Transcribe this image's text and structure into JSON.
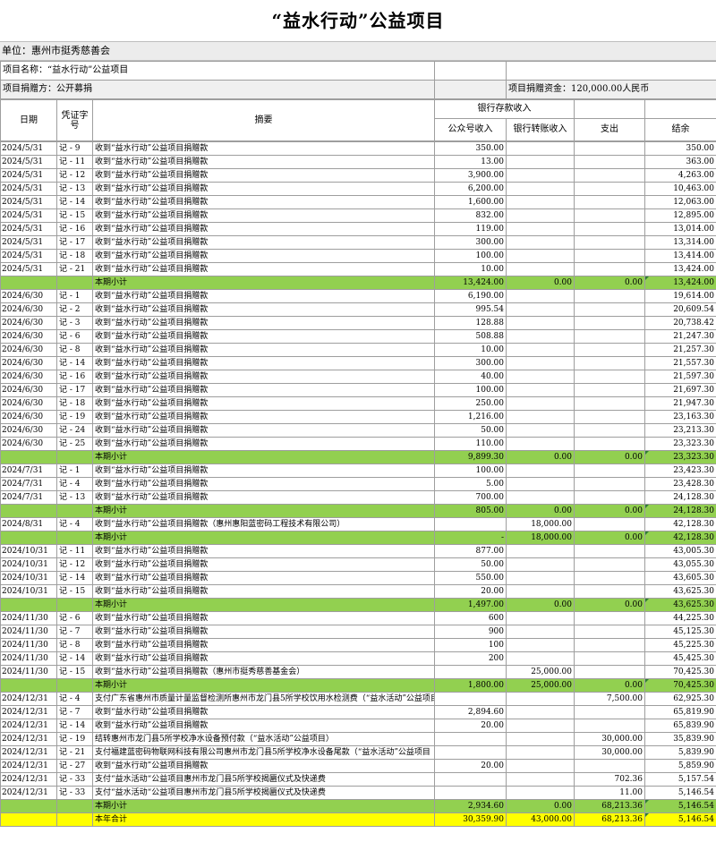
{
  "title": "“益水行动”公益项目",
  "unit_label": "单位：惠州市挺秀慈善会",
  "project_name": "项目名称：“益水行动”公益项目",
  "donation_method": "项目捐赠方：公开募捐",
  "donation_fund": "项目捐赠资金：120,000.00人民币",
  "headers": {
    "date": "日期",
    "voucher": "凭证字号",
    "summary": "摘要",
    "bank": "银行存款收入",
    "public_income": "公众号收入",
    "transfer_income": "银行转账收入",
    "expense": "支出",
    "balance": "结余"
  },
  "rows": [
    {
      "type": "entry",
      "date": "2024/5/31",
      "voucher": "记 - 9",
      "summary": "收到“益水行动”公益项目捐赠款",
      "pub": "350.00",
      "trans": "",
      "exp": "",
      "bal": "350.00"
    },
    {
      "type": "entry",
      "date": "2024/5/31",
      "voucher": "记 - 11",
      "summary": "收到“益水行动”公益项目捐赠款",
      "pub": "13.00",
      "trans": "",
      "exp": "",
      "bal": "363.00"
    },
    {
      "type": "entry",
      "date": "2024/5/31",
      "voucher": "记 - 12",
      "summary": "收到“益水行动”公益项目捐赠款",
      "pub": "3,900.00",
      "trans": "",
      "exp": "",
      "bal": "4,263.00"
    },
    {
      "type": "entry",
      "date": "2024/5/31",
      "voucher": "记 - 13",
      "summary": "收到“益水行动”公益项目捐赠款",
      "pub": "6,200.00",
      "trans": "",
      "exp": "",
      "bal": "10,463.00"
    },
    {
      "type": "entry",
      "date": "2024/5/31",
      "voucher": "记 - 14",
      "summary": "收到“益水行动”公益项目捐赠款",
      "pub": "1,600.00",
      "trans": "",
      "exp": "",
      "bal": "12,063.00"
    },
    {
      "type": "entry",
      "date": "2024/5/31",
      "voucher": "记 - 15",
      "summary": "收到“益水行动”公益项目捐赠款",
      "pub": "832.00",
      "trans": "",
      "exp": "",
      "bal": "12,895.00"
    },
    {
      "type": "entry",
      "date": "2024/5/31",
      "voucher": "记 - 16",
      "summary": "收到“益水行动”公益项目捐赠款",
      "pub": "119.00",
      "trans": "",
      "exp": "",
      "bal": "13,014.00"
    },
    {
      "type": "entry",
      "date": "2024/5/31",
      "voucher": "记 - 17",
      "summary": "收到“益水行动”公益项目捐赠款",
      "pub": "300.00",
      "trans": "",
      "exp": "",
      "bal": "13,314.00"
    },
    {
      "type": "entry",
      "date": "2024/5/31",
      "voucher": "记 - 18",
      "summary": "收到“益水行动”公益项目捐赠款",
      "pub": "100.00",
      "trans": "",
      "exp": "",
      "bal": "13,414.00"
    },
    {
      "type": "entry",
      "date": "2024/5/31",
      "voucher": "记 - 21",
      "summary": "收到“益水行动”公益项目捐赠款",
      "pub": "10.00",
      "trans": "",
      "exp": "",
      "bal": "13,424.00"
    },
    {
      "type": "sub",
      "summary": "本期小计",
      "pub": "13,424.00",
      "trans": "0.00",
      "exp": "0.00",
      "bal": "13,424.00"
    },
    {
      "type": "entry",
      "date": "2024/6/30",
      "voucher": "记 - 1",
      "summary": "收到“益水行动”公益项目捐赠款",
      "pub": "6,190.00",
      "trans": "",
      "exp": "",
      "bal": "19,614.00"
    },
    {
      "type": "entry",
      "date": "2024/6/30",
      "voucher": "记 - 2",
      "summary": "收到“益水行动”公益项目捐赠款",
      "pub": "995.54",
      "trans": "",
      "exp": "",
      "bal": "20,609.54"
    },
    {
      "type": "entry",
      "date": "2024/6/30",
      "voucher": "记 - 3",
      "summary": "收到“益水行动”公益项目捐赠款",
      "pub": "128.88",
      "trans": "",
      "exp": "",
      "bal": "20,738.42"
    },
    {
      "type": "entry",
      "date": "2024/6/30",
      "voucher": "记 - 6",
      "summary": "收到“益水行动”公益项目捐赠款",
      "pub": "508.88",
      "trans": "",
      "exp": "",
      "bal": "21,247.30"
    },
    {
      "type": "entry",
      "date": "2024/6/30",
      "voucher": "记 - 8",
      "summary": "收到“益水行动”公益项目捐赠款",
      "pub": "10.00",
      "trans": "",
      "exp": "",
      "bal": "21,257.30"
    },
    {
      "type": "entry",
      "date": "2024/6/30",
      "voucher": "记 - 14",
      "summary": "收到“益水行动”公益项目捐赠款",
      "pub": "300.00",
      "trans": "",
      "exp": "",
      "bal": "21,557.30"
    },
    {
      "type": "entry",
      "date": "2024/6/30",
      "voucher": "记 - 16",
      "summary": "收到“益水行动”公益项目捐赠款",
      "pub": "40.00",
      "trans": "",
      "exp": "",
      "bal": "21,597.30"
    },
    {
      "type": "entry",
      "date": "2024/6/30",
      "voucher": "记 - 17",
      "summary": "收到“益水行动”公益项目捐赠款",
      "pub": "100.00",
      "trans": "",
      "exp": "",
      "bal": "21,697.30"
    },
    {
      "type": "entry",
      "date": "2024/6/30",
      "voucher": "记 - 18",
      "summary": "收到“益水行动”公益项目捐赠款",
      "pub": "250.00",
      "trans": "",
      "exp": "",
      "bal": "21,947.30"
    },
    {
      "type": "entry",
      "date": "2024/6/30",
      "voucher": "记 - 19",
      "summary": "收到“益水行动”公益项目捐赠款",
      "pub": "1,216.00",
      "trans": "",
      "exp": "",
      "bal": "23,163.30"
    },
    {
      "type": "entry",
      "date": "2024/6/30",
      "voucher": "记 - 24",
      "summary": "收到“益水行动”公益项目捐赠款",
      "pub": "50.00",
      "trans": "",
      "exp": "",
      "bal": "23,213.30"
    },
    {
      "type": "entry",
      "date": "2024/6/30",
      "voucher": "记 - 25",
      "summary": "收到“益水行动”公益项目捐赠款",
      "pub": "110.00",
      "trans": "",
      "exp": "",
      "bal": "23,323.30"
    },
    {
      "type": "sub",
      "summary": "本期小计",
      "pub": "9,899.30",
      "trans": "0.00",
      "exp": "0.00",
      "bal": "23,323.30"
    },
    {
      "type": "entry",
      "date": "2024/7/31",
      "voucher": "记 - 1",
      "summary": "收到“益水行动”公益项目捐赠款",
      "pub": "100.00",
      "trans": "",
      "exp": "",
      "bal": "23,423.30"
    },
    {
      "type": "entry",
      "date": "2024/7/31",
      "voucher": "记 - 4",
      "summary": "收到“益水行动”公益项目捐赠款",
      "pub": "5.00",
      "trans": "",
      "exp": "",
      "bal": "23,428.30"
    },
    {
      "type": "entry",
      "date": "2024/7/31",
      "voucher": "记 - 13",
      "summary": "收到“益水行动”公益项目捐赠款",
      "pub": "700.00",
      "trans": "",
      "exp": "",
      "bal": "24,128.30"
    },
    {
      "type": "sub",
      "summary": "本期小计",
      "pub": "805.00",
      "trans": "0.00",
      "exp": "0.00",
      "bal": "24,128.30"
    },
    {
      "type": "entry",
      "date": "2024/8/31",
      "voucher": "记 - 4",
      "summary": "收到“益水行动”公益项目捐赠款（惠州惠阳蓝密码工程技术有限公司）",
      "pub": "",
      "trans": "18,000.00",
      "exp": "",
      "bal": "42,128.30"
    },
    {
      "type": "sub",
      "summary": "本期小计",
      "pub": "-",
      "trans": "18,000.00",
      "exp": "0.00",
      "bal": "42,128.30"
    },
    {
      "type": "entry",
      "date": "2024/10/31",
      "voucher": "记 - 11",
      "summary": "收到“益水行动”公益项目捐赠款",
      "pub": "877.00",
      "trans": "",
      "exp": "",
      "bal": "43,005.30"
    },
    {
      "type": "entry",
      "date": "2024/10/31",
      "voucher": "记 - 12",
      "summary": "收到“益水行动”公益项目捐赠款",
      "pub": "50.00",
      "trans": "",
      "exp": "",
      "bal": "43,055.30"
    },
    {
      "type": "entry",
      "date": "2024/10/31",
      "voucher": "记 - 14",
      "summary": "收到“益水行动”公益项目捐赠款",
      "pub": "550.00",
      "trans": "",
      "exp": "",
      "bal": "43,605.30"
    },
    {
      "type": "entry",
      "date": "2024/10/31",
      "voucher": "记 - 15",
      "summary": "收到“益水行动”公益项目捐赠款",
      "pub": "20.00",
      "trans": "",
      "exp": "",
      "bal": "43,625.30"
    },
    {
      "type": "sub",
      "summary": "本期小计",
      "pub": "1,497.00",
      "trans": "0.00",
      "exp": "0.00",
      "bal": "43,625.30"
    },
    {
      "type": "entry",
      "date": "2024/11/30",
      "voucher": "记 - 6",
      "summary": "收到“益水行动”公益项目捐赠款",
      "pub": "600",
      "trans": "",
      "exp": "",
      "bal": "44,225.30"
    },
    {
      "type": "entry",
      "date": "2024/11/30",
      "voucher": "记 - 7",
      "summary": "收到“益水行动”公益项目捐赠款",
      "pub": "900",
      "trans": "",
      "exp": "",
      "bal": "45,125.30"
    },
    {
      "type": "entry",
      "date": "2024/11/30",
      "voucher": "记 - 8",
      "summary": "收到“益水行动”公益项目捐赠款",
      "pub": "100",
      "trans": "",
      "exp": "",
      "bal": "45,225.30"
    },
    {
      "type": "entry",
      "date": "2024/11/30",
      "voucher": "记 - 14",
      "summary": "收到“益水行动”公益项目捐赠款",
      "pub": "200",
      "trans": "",
      "exp": "",
      "bal": "45,425.30"
    },
    {
      "type": "entry",
      "date": "2024/11/30",
      "voucher": "记 - 15",
      "summary": "收到“益水行动”公益项目捐赠款（惠州市挺秀慈善基金会）",
      "pub": "",
      "trans": "25,000.00",
      "exp": "",
      "bal": "70,425.30"
    },
    {
      "type": "sub",
      "summary": "本期小计",
      "pub": "1,800.00",
      "trans": "25,000.00",
      "exp": "0.00",
      "bal": "70,425.30"
    },
    {
      "type": "entry",
      "date": "2024/12/31",
      "voucher": "记 - 4",
      "summary": "支付广东省惠州市质量计量监督检测所惠州市龙门县5所学校饮用水检测费（“益水活动”公益项目）",
      "pub": "",
      "trans": "",
      "exp": "7,500.00",
      "bal": "62,925.30"
    },
    {
      "type": "entry",
      "date": "2024/12/31",
      "voucher": "记 - 7",
      "summary": "收到“益水行动”公益项目捐赠款",
      "pub": "2,894.60",
      "trans": "",
      "exp": "",
      "bal": "65,819.90"
    },
    {
      "type": "entry",
      "date": "2024/12/31",
      "voucher": "记 - 14",
      "summary": "收到“益水行动”公益项目捐赠款",
      "pub": "20.00",
      "trans": "",
      "exp": "",
      "bal": "65,839.90"
    },
    {
      "type": "entry",
      "date": "2024/12/31",
      "voucher": "记 - 19",
      "summary": "结转惠州市龙门县5所学校净水设备预付款（“益水活动”公益项目）",
      "pub": "",
      "trans": "",
      "exp": "30,000.00",
      "bal": "35,839.90"
    },
    {
      "type": "entry",
      "date": "2024/12/31",
      "voucher": "记 - 21",
      "summary": "支付福建蓝密码物联网科技有限公司惠州市龙门县5所学校净水设备尾款（“益水活动”公益项目",
      "pub": "",
      "trans": "",
      "exp": "30,000.00",
      "bal": "5,839.90"
    },
    {
      "type": "entry",
      "date": "2024/12/31",
      "voucher": "记 - 27",
      "summary": "收到“益水行动”公益项目捐赠款",
      "pub": "20.00",
      "trans": "",
      "exp": "",
      "bal": "5,859.90"
    },
    {
      "type": "entry",
      "date": "2024/12/31",
      "voucher": "记 - 33",
      "summary": "支付“益水活动“公益项目惠州市龙门县5所学校揭匾仪式及快递费",
      "pub": "",
      "trans": "",
      "exp": "702.36",
      "bal": "5,157.54"
    },
    {
      "type": "entry",
      "date": "2024/12/31",
      "voucher": "记 - 33",
      "summary": "支付“益水活动“公益项目惠州市龙门县5所学校揭匾仪式及快递费",
      "pub": "",
      "trans": "",
      "exp": "11.00",
      "bal": "5,146.54"
    },
    {
      "type": "sub",
      "summary": "本期小计",
      "pub": "2,934.60",
      "trans": "0.00",
      "exp": "68,213.36",
      "bal": "5,146.54"
    },
    {
      "type": "year",
      "summary": "本年合计",
      "pub": "30,359.90",
      "trans": "43,000.00",
      "exp": "68,213.36",
      "bal": "5,146.54"
    }
  ]
}
